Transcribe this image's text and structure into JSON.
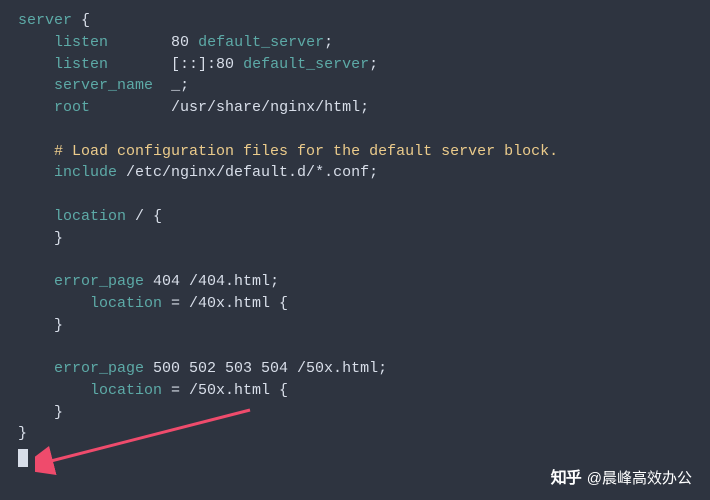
{
  "code": {
    "l01_server": "server",
    "l01_brace": " {",
    "l02_listen": "listen",
    "l02_port": "80 ",
    "l02_default": "default_server",
    "l03_listen": "listen",
    "l03_addr": "[::]:80 ",
    "l03_default": "default_server",
    "l04_servername": "server_name",
    "l04_underscore": "_",
    "l05_root": "root",
    "l05_path": "/usr/share/nginx/html",
    "l07_comment": "# Load configuration files for the default server block.",
    "l08_include": "include",
    "l08_path": " /etc/nginx/default.d/*.conf",
    "l10_location": "location",
    "l10_slash": " / {",
    "l11_close": "}",
    "l13_errorpage": "error_page",
    "l13_codes": " 404 /404.html",
    "l14_location": "location",
    "l14_rest": " = /40x.html {",
    "l15_close": "}",
    "l17_errorpage": "error_page",
    "l17_codes": " 500 502 503 504 /50x.html",
    "l18_location": "location",
    "l18_rest": " = /50x.html {",
    "l19_close": "}",
    "l20_close": "}"
  },
  "watermark": {
    "logo": "知乎",
    "author": "@晨峰高效办公"
  }
}
